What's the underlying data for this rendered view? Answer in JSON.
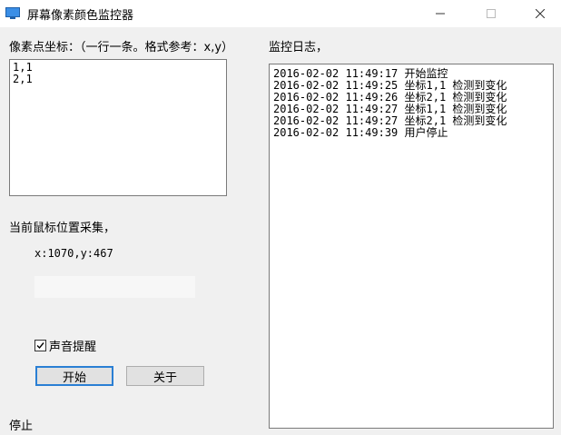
{
  "window": {
    "title": "屏幕像素颜色监控器"
  },
  "coords_panel": {
    "label": "像素点坐标：（一行一条。格式参考：x,y）",
    "lines": [
      "1,1",
      "2,1"
    ]
  },
  "log_panel": {
    "label": "监控日志，",
    "entries": [
      "2016-02-02 11:49:17 开始监控",
      "2016-02-02 11:49:25 坐标1,1 检测到变化",
      "2016-02-02 11:49:26 坐标2,1 检测到变化",
      "2016-02-02 11:49:27 坐标1,1 检测到变化",
      "2016-02-02 11:49:27 坐标2,1 检测到变化",
      "2016-02-02 11:49:39 用户停止"
    ]
  },
  "mouse_panel": {
    "label": "当前鼠标位置采集，",
    "coord_text": "x:1070,y:467",
    "swatch_color": "#f7f7f7"
  },
  "options": {
    "sound_label": "声音提醒",
    "sound_checked": true
  },
  "buttons": {
    "start_label": "开始",
    "about_label": "关于"
  },
  "status": {
    "text": "停止"
  },
  "colors": {
    "client_bg": "#f0f0f0",
    "focus_border": "#2a7fd4"
  }
}
